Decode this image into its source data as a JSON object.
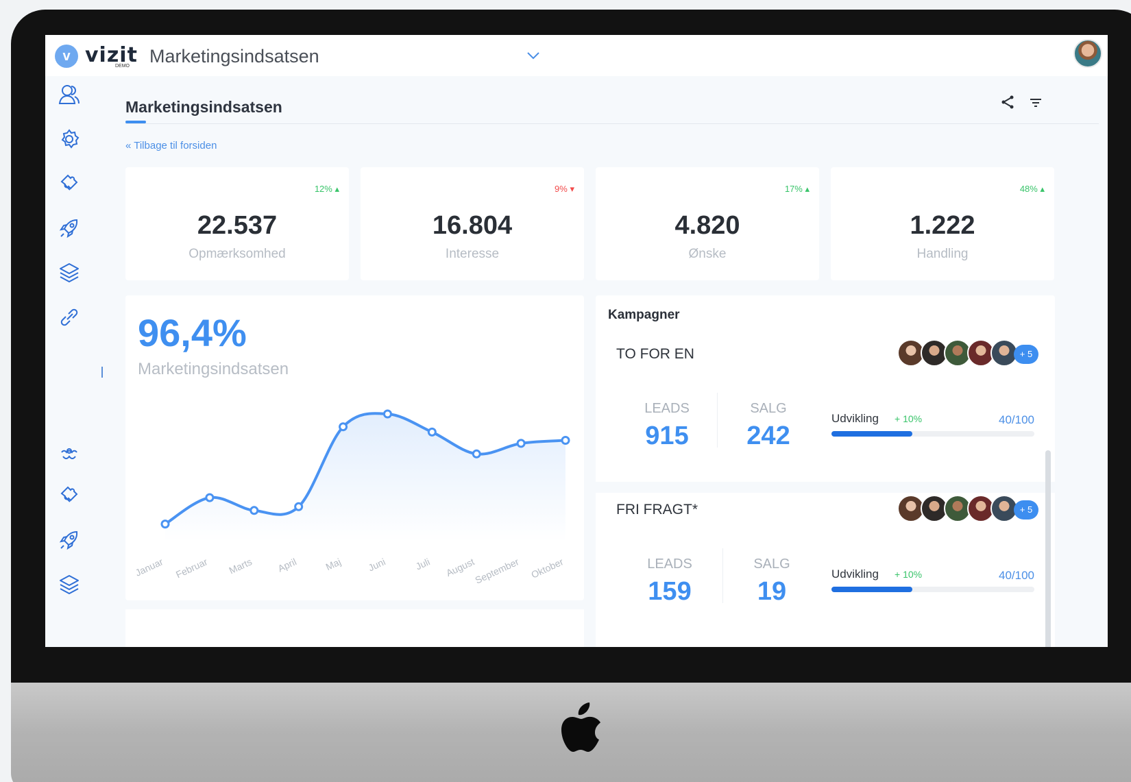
{
  "app": {
    "logo_letter": "v",
    "logo_text": "vizit",
    "logo_sub": "DEMO",
    "title": "Marketingsindsatsen"
  },
  "page": {
    "title": "Marketingsindsatsen",
    "back_link": "« Tilbage til forsiden"
  },
  "sidebar": {
    "items": [
      {
        "icon": "users-icon"
      },
      {
        "icon": "gear-icon"
      },
      {
        "icon": "puzzle-icon"
      },
      {
        "icon": "rocket-icon"
      },
      {
        "icon": "layers-icon"
      },
      {
        "icon": "link-icon"
      },
      {
        "icon": "cogs-icon"
      },
      {
        "icon": "puzzle-icon"
      },
      {
        "icon": "rocket-icon"
      },
      {
        "icon": "layers-icon"
      }
    ]
  },
  "stats": [
    {
      "value": "22.537",
      "label": "Opmærksomhed",
      "delta": "12%",
      "trend": "up"
    },
    {
      "value": "16.804",
      "label": "Interesse",
      "delta": "9%",
      "trend": "down"
    },
    {
      "value": "4.820",
      "label": "Ønske",
      "delta": "17%",
      "trend": "up"
    },
    {
      "value": "1.222",
      "label": "Handling",
      "delta": "48%",
      "trend": "up"
    }
  ],
  "overview": {
    "value": "96,4%",
    "label": "Marketingsindsatsen"
  },
  "chart_data": {
    "type": "line",
    "categories": [
      "Januar",
      "Februar",
      "Marts",
      "April",
      "Maj",
      "Juni",
      "Juli",
      "August",
      "September",
      "Oktober"
    ],
    "values": [
      24,
      59,
      42,
      47,
      153,
      170,
      146,
      117,
      131,
      135
    ],
    "ylim": [
      0,
      200
    ],
    "grid": false,
    "color": "#4a93f2"
  },
  "campaigns": {
    "heading": "Kampagner",
    "items": [
      {
        "name": "TO FOR EN",
        "leads_label": "LEADS",
        "leads": "915",
        "salg_label": "SALG",
        "salg": "242",
        "dev_label": "Udvikling",
        "dev_delta": "+ 10%",
        "dev_count": "40/100",
        "progress": 0.4,
        "more": "+ 5"
      },
      {
        "name": "FRI FRAGT*",
        "leads_label": "LEADS",
        "leads": "159",
        "salg_label": "SALG",
        "salg": "19",
        "dev_label": "Udvikling",
        "dev_delta": "+ 10%",
        "dev_count": "40/100",
        "progress": 0.4,
        "more": "+ 5"
      }
    ]
  },
  "colors": {
    "accent": "#3d8ef0",
    "up": "#39c46a",
    "down": "#f24b4b"
  }
}
